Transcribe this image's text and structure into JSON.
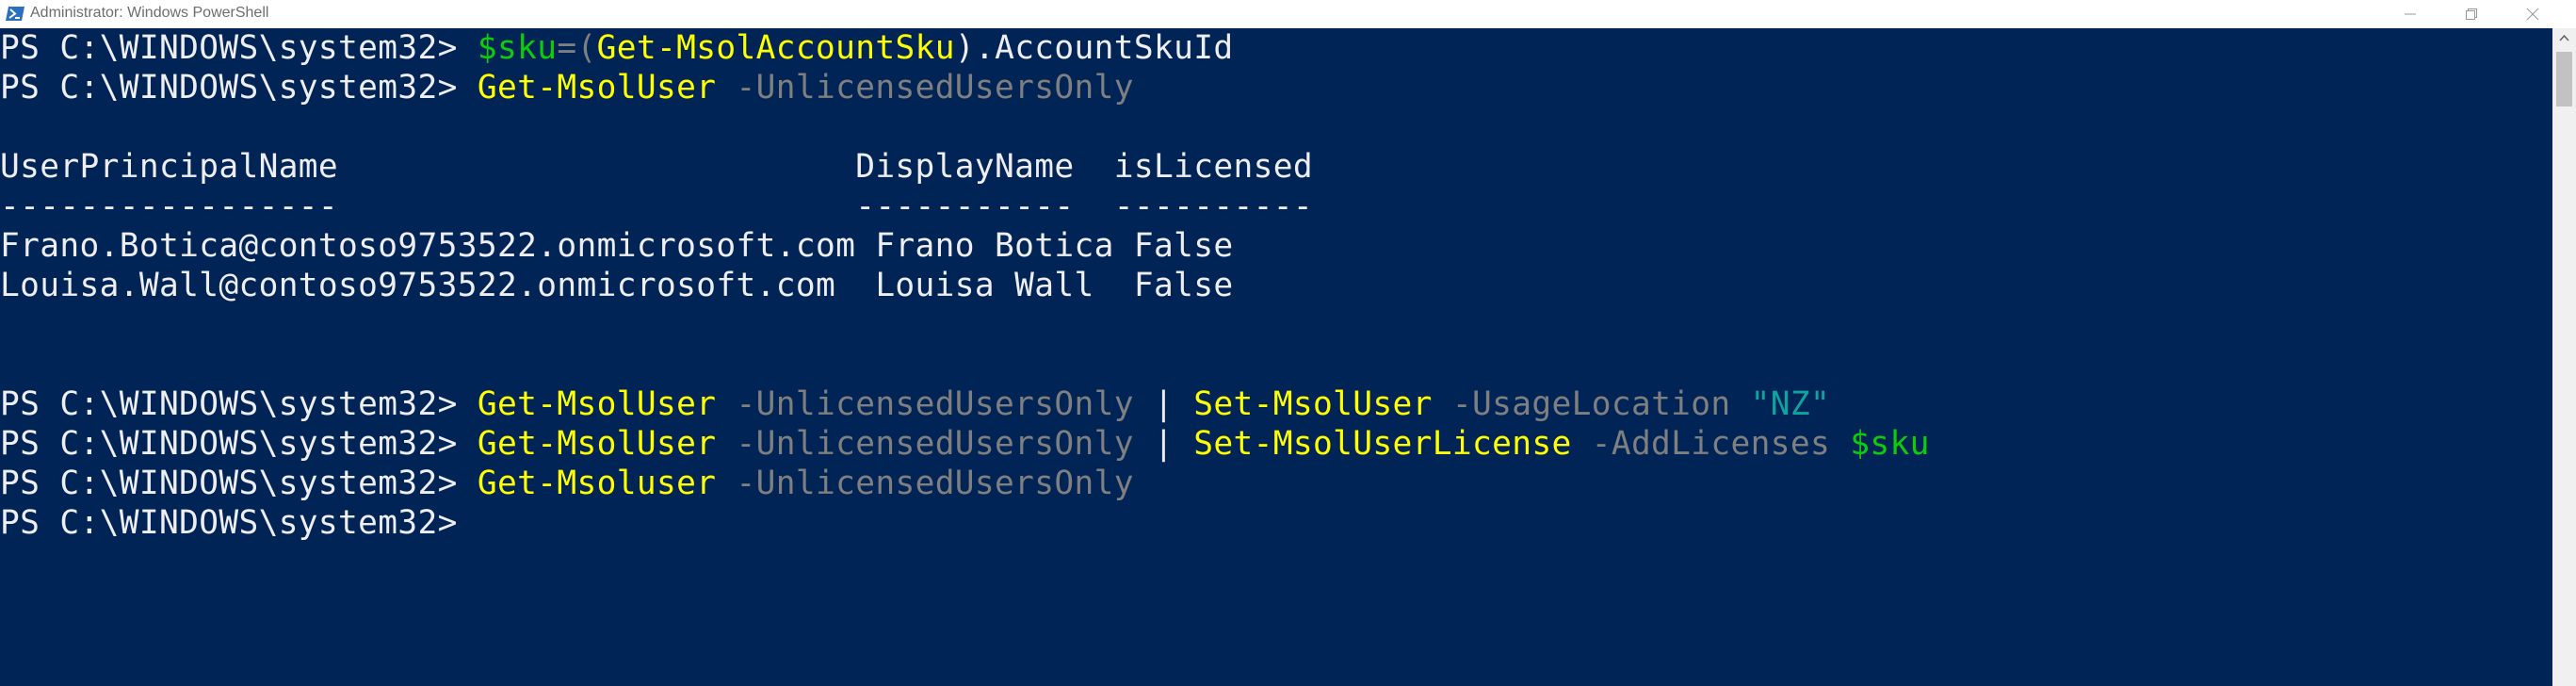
{
  "window": {
    "title": "Administrator: Windows PowerShell",
    "icons": [
      "powershell-icon",
      "minimize-icon",
      "maximize-icon",
      "close-icon"
    ]
  },
  "colors": {
    "background": "#012456",
    "text": "#eeedf0",
    "command": "#ffff00",
    "variable": "#0ccc0c",
    "parameter": "#7f7f7f",
    "string": "#0ea2a0"
  },
  "prompt": "PS C:\\WINDOWS\\system32> ",
  "lines": {
    "l1": {
      "var": "$sku",
      "op": "=(",
      "cmd": "Get-MsolAccountSku",
      "rest": ").AccountSkuId"
    },
    "l2": {
      "cmd": "Get-MsolUser",
      "param": " -UnlicensedUsersOnly"
    },
    "header": "UserPrincipalName                          DisplayName  isLicensed",
    "separator": "-----------------                          -----------  ----------",
    "row1": "Frano.Botica@contoso9753522.onmicrosoft.com Frano Botica False",
    "row2": "Louisa.Wall@contoso9753522.onmicrosoft.com  Louisa Wall  False",
    "l3": {
      "cmd1": "Get-MsolUser",
      "param1": " -UnlicensedUsersOnly",
      "pipe": " | ",
      "cmd2": "Set-MsolUser",
      "param2": " -UsageLocation ",
      "str": "\"NZ\""
    },
    "l4": {
      "cmd1": "Get-MsolUser",
      "param1": " -UnlicensedUsersOnly",
      "pipe": " | ",
      "cmd2": "Set-MsolUserLicense",
      "param2": " -AddLicenses ",
      "var": "$sku"
    },
    "l5": {
      "cmd": "Get-Msoluser",
      "param": " -UnlicensedUsersOnly"
    }
  }
}
